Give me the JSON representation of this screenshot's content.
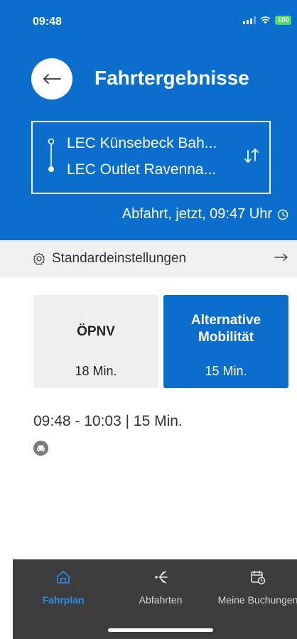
{
  "status_bar": {
    "time": "09:48",
    "battery": "100",
    "icons": [
      "signal-icon",
      "wifi-icon",
      "battery-icon"
    ]
  },
  "header": {
    "back_icon": "arrow-left-icon",
    "title": "Fahrtergebnisse",
    "background": "#0a6fcc"
  },
  "route": {
    "from": "LEC Künsebeck Bah...",
    "to": "LEC Outlet Ravenna...",
    "swap_icon": "swap-vertical-icon"
  },
  "departure": {
    "label": "Abfahrt, jetzt, 09:47 Uhr",
    "icon": "clock-icon"
  },
  "settings": {
    "label": "Standardeinstellungen",
    "icon": "gear-icon",
    "arrow_icon": "arrow-right-icon"
  },
  "mode_tabs": [
    {
      "title": "ÖPNV",
      "duration": "18 Min.",
      "selected": false
    },
    {
      "title_line1": "Alternative",
      "title_line2": "Mobilität",
      "duration": "15 Min.",
      "selected": true
    }
  ],
  "result": {
    "time_range": "09:48 - 10:03 | 15 Min.",
    "mode_icon": "car-icon"
  },
  "tabbar": {
    "items": [
      {
        "label": "Fahrplan",
        "icon": "home-icon",
        "active": true
      },
      {
        "label": "Abfahrten",
        "icon": "departures-icon",
        "active": false
      },
      {
        "label": "Meine Buchungen",
        "icon": "calendar-clock-icon",
        "active": false
      }
    ],
    "active_color": "#2a8ee6"
  }
}
